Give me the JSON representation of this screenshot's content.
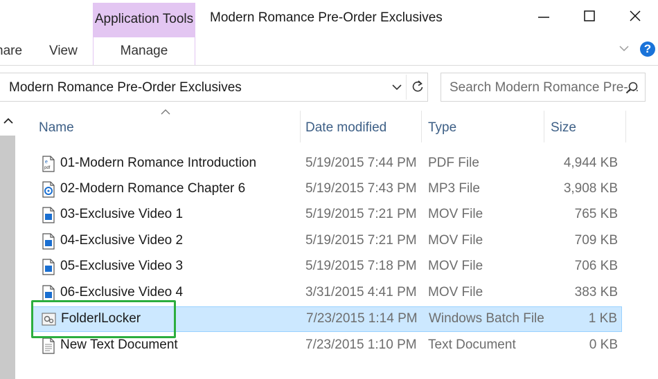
{
  "ribbon": {
    "contextual_tab_group": "Application Tools",
    "tabs": [
      {
        "label": "nare"
      },
      {
        "label": "View"
      },
      {
        "label": "Manage"
      }
    ],
    "contextual_color": "#e3c6f2"
  },
  "window": {
    "title": "Modern Romance Pre-Order Exclusives",
    "help": "?"
  },
  "address_bar": {
    "path": "Modern Romance Pre-Order Exclusives"
  },
  "search": {
    "placeholder": "Search Modern Romance Pre-..."
  },
  "columns": [
    "Name",
    "Date modified",
    "Type",
    "Size"
  ],
  "files": [
    {
      "name": "01-Modern Romance Introduction",
      "date": "5/19/2015 7:44 PM",
      "type": "PDF File",
      "size": "4,944 KB",
      "icon": "pdf-file-icon"
    },
    {
      "name": "02-Modern Romance Chapter 6",
      "date": "5/19/2015 7:43 PM",
      "type": "MP3 File",
      "size": "3,908 KB",
      "icon": "mp3-file-icon"
    },
    {
      "name": "03-Exclusive Video 1",
      "date": "5/19/2015 7:21 PM",
      "type": "MOV File",
      "size": "765 KB",
      "icon": "mov-file-icon"
    },
    {
      "name": "04-Exclusive Video 2",
      "date": "5/19/2015 7:21 PM",
      "type": "MOV File",
      "size": "709 KB",
      "icon": "mov-file-icon"
    },
    {
      "name": "05-Exclusive Video 3",
      "date": "5/19/2015 7:18 PM",
      "type": "MOV File",
      "size": "706 KB",
      "icon": "mov-file-icon"
    },
    {
      "name": "06-Exclusive Video 4",
      "date": "3/31/2015 4:41 PM",
      "type": "MOV File",
      "size": "383 KB",
      "icon": "mov-file-icon"
    },
    {
      "name": "FolderlLocker",
      "date": "7/23/2015 1:14 PM",
      "type": "Windows Batch File",
      "size": "1 KB",
      "icon": "batch-file-icon",
      "selected": true
    },
    {
      "name": "New Text Document",
      "date": "7/23/2015 1:10 PM",
      "type": "Text Document",
      "size": "0 KB",
      "icon": "text-file-icon"
    }
  ],
  "colors": {
    "selection": "#cce8ff",
    "highlight_box": "#2cae3e",
    "header_text": "#3d5f86",
    "help": "#1a73d9"
  }
}
